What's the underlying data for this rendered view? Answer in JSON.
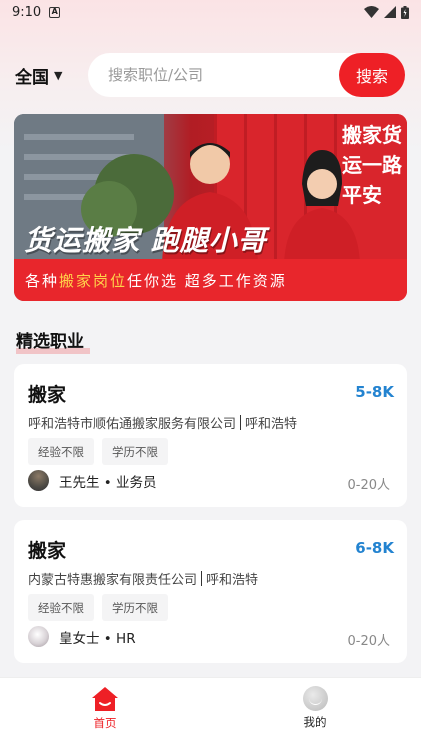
{
  "status_bar": {
    "time": "9:10",
    "notification_icon": "a-square-icon"
  },
  "header": {
    "region": "全国",
    "search_placeholder": "搜索职位/公司",
    "search_button": "搜索"
  },
  "banner": {
    "headline": "货运搬家  跑腿小哥",
    "subline_parts": [
      "各种",
      "搬家岗位",
      "任你选  超多工作资源"
    ],
    "slogan": "搬家货运一路平安",
    "colors": {
      "primary": "#e8262c",
      "highlight": "#ffd34a"
    }
  },
  "section": {
    "title": "精选职业"
  },
  "jobs": [
    {
      "title": "搬家",
      "salary": "5-8K",
      "company": "呼和浩特市顺佑通搬家服务有限公司",
      "city": "呼和浩特",
      "tags": [
        "经验不限",
        "学历不限"
      ],
      "recruiter": "王先生 • 业务员",
      "headcount": "0-20人"
    },
    {
      "title": "搬家",
      "salary": "6-8K",
      "company": "内蒙古特惠搬家有限责任公司",
      "city": "呼和浩特",
      "tags": [
        "经验不限",
        "学历不限"
      ],
      "recruiter": "皇女士 • HR",
      "headcount": "0-20人"
    }
  ],
  "bottom_nav": {
    "items": [
      {
        "label": "首页",
        "icon": "home-icon",
        "active": true
      },
      {
        "label": "我的",
        "icon": "profile-icon",
        "active": false
      }
    ]
  },
  "colors": {
    "accent": "#ee2026",
    "salary": "#2383d0"
  }
}
